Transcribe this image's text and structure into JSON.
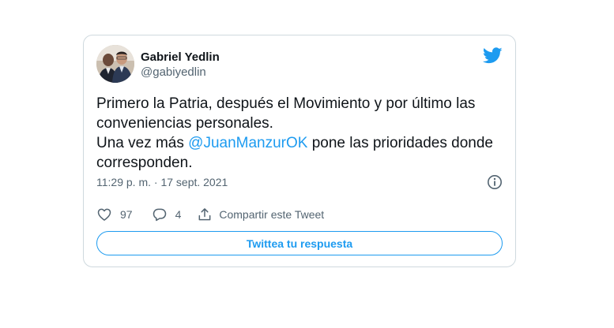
{
  "tweet": {
    "author_name": "Gabriel Yedlin",
    "author_handle": "@gabiyedlin",
    "text_line1": "Primero la Patria, después el Movimiento y por último las conveniencias personales.",
    "text_line2_before": "Una vez más ",
    "mention": "@JuanManzurOK",
    "text_line2_after": " pone las prioridades donde corresponden.",
    "timestamp": "11:29 p. m. · 17 sept. 2021",
    "like_count": "97",
    "reply_count": "4",
    "share_label": "Compartir este Tweet",
    "reply_button_label": "Twittea tu respuesta"
  },
  "icons": {
    "brand": "twitter-bird-icon",
    "info": "info-icon",
    "like": "heart-icon",
    "reply": "comment-icon",
    "share": "share-icon"
  },
  "colors": {
    "accent": "#1d9bf0",
    "text": "#0f1419",
    "muted": "#536471",
    "border": "#cfd9de"
  }
}
